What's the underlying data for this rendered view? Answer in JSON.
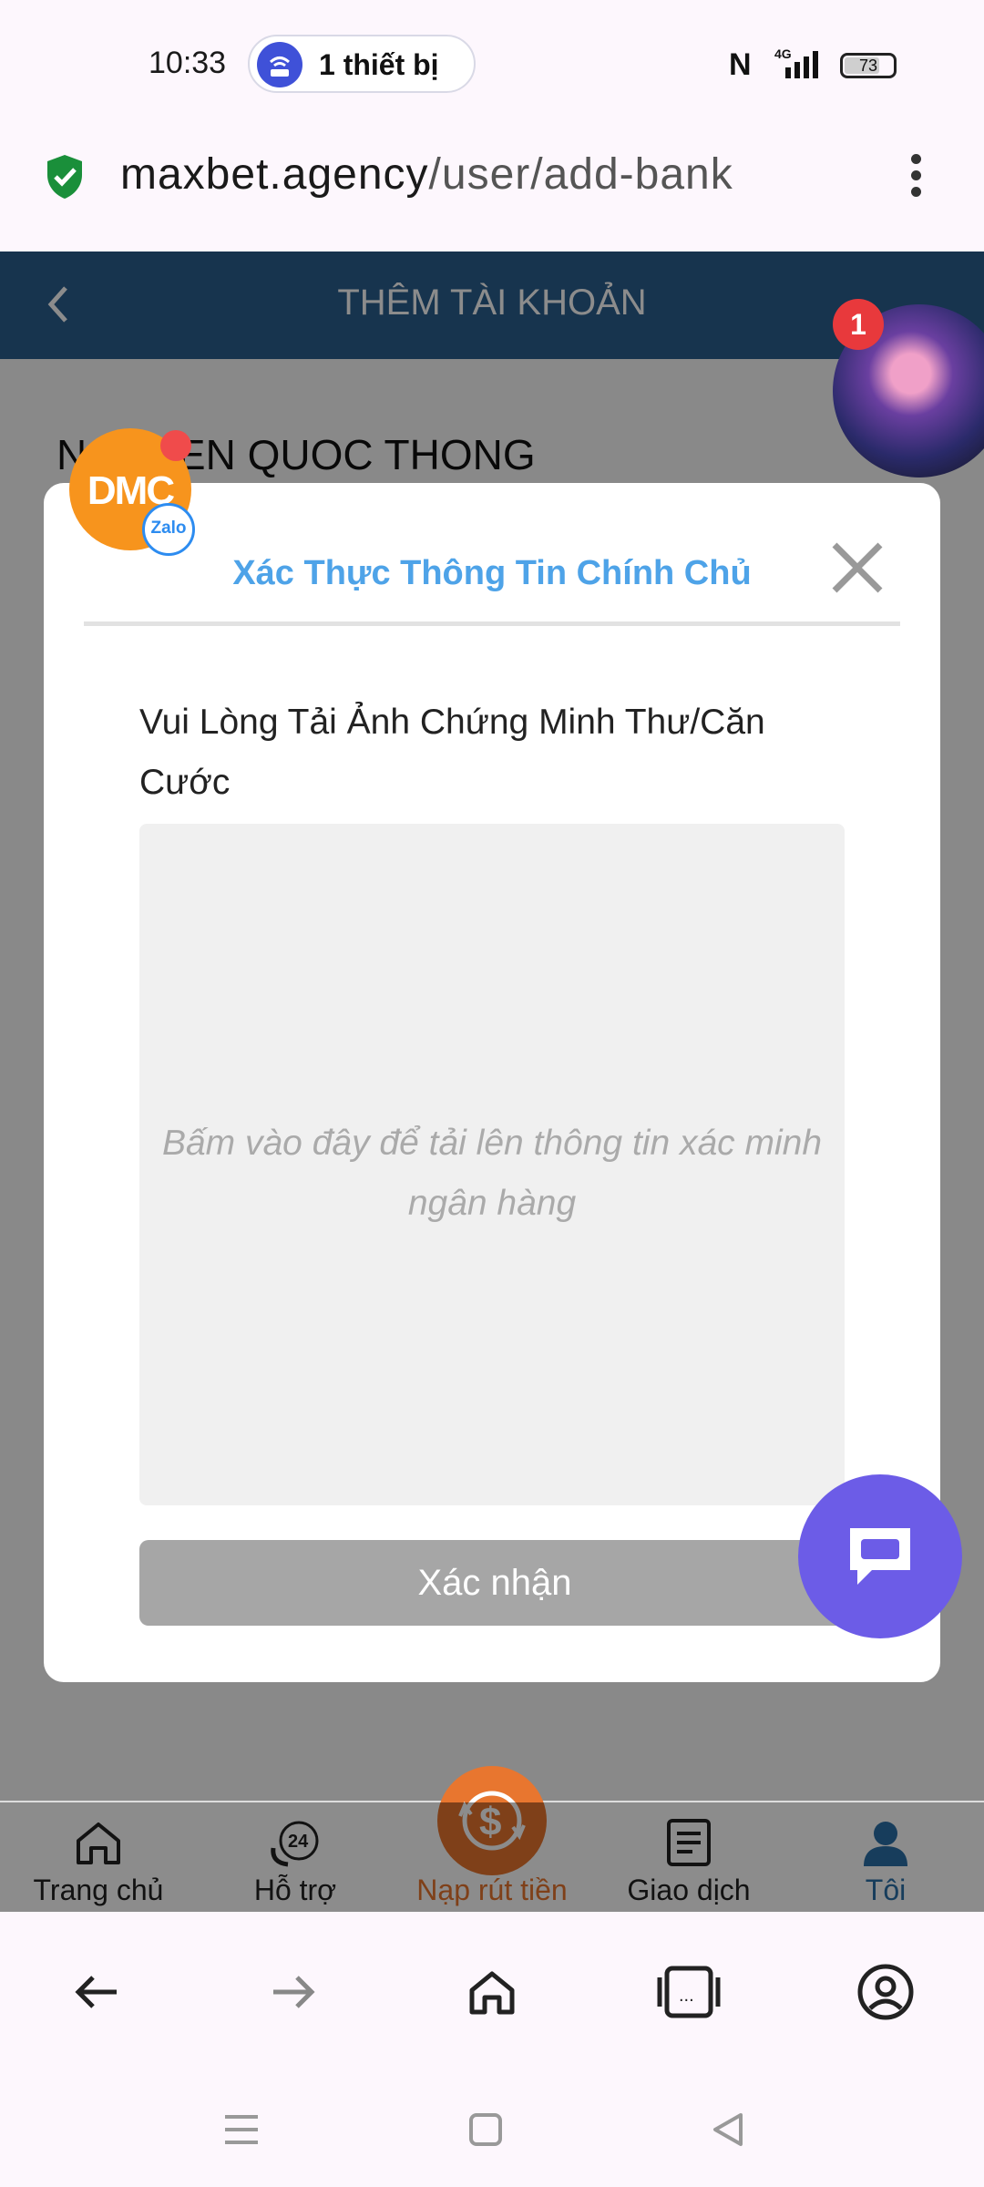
{
  "status_bar": {
    "time": "10:33",
    "hotspot_label": "1 thiết bị",
    "nfc_icon": "nfc-icon",
    "network": "4G",
    "battery": "73"
  },
  "url_bar": {
    "domain": "maxbet.agency",
    "path": "/user/add-bank",
    "secure_icon": "shield-check-icon",
    "secure_color": "#1a8f3a"
  },
  "page": {
    "title": "THÊM TÀI KHOẢN",
    "account_name": "NGUYEN QUOC THONG",
    "header_color": "#2b5f8e"
  },
  "modal": {
    "title": "Xác Thực Thông Tin Chính Chủ",
    "upload_label": "Vui Lòng Tải Ảnh Chứng Minh Thư/Căn Cước",
    "upload_hint": "Bấm vào đây để tải lên thông tin xác minh ngân hàng",
    "confirm_label": "Xác nhận",
    "title_color": "#4ea3e8"
  },
  "floating": {
    "zalo_logo": "DMC",
    "zalo_label": "Zalo",
    "notification_count": "1"
  },
  "bottom_nav": {
    "items": [
      {
        "label": "Trang chủ",
        "icon": "home-icon"
      },
      {
        "label": "Hỗ trợ",
        "icon": "support-24-icon"
      },
      {
        "label": "Nạp rút tiền",
        "icon": "dollar-exchange-icon",
        "color": "#e8762f"
      },
      {
        "label": "Giao dịch",
        "icon": "transaction-list-icon"
      },
      {
        "label": "Tôi",
        "icon": "user-icon",
        "color": "#2b6fa8"
      }
    ]
  }
}
